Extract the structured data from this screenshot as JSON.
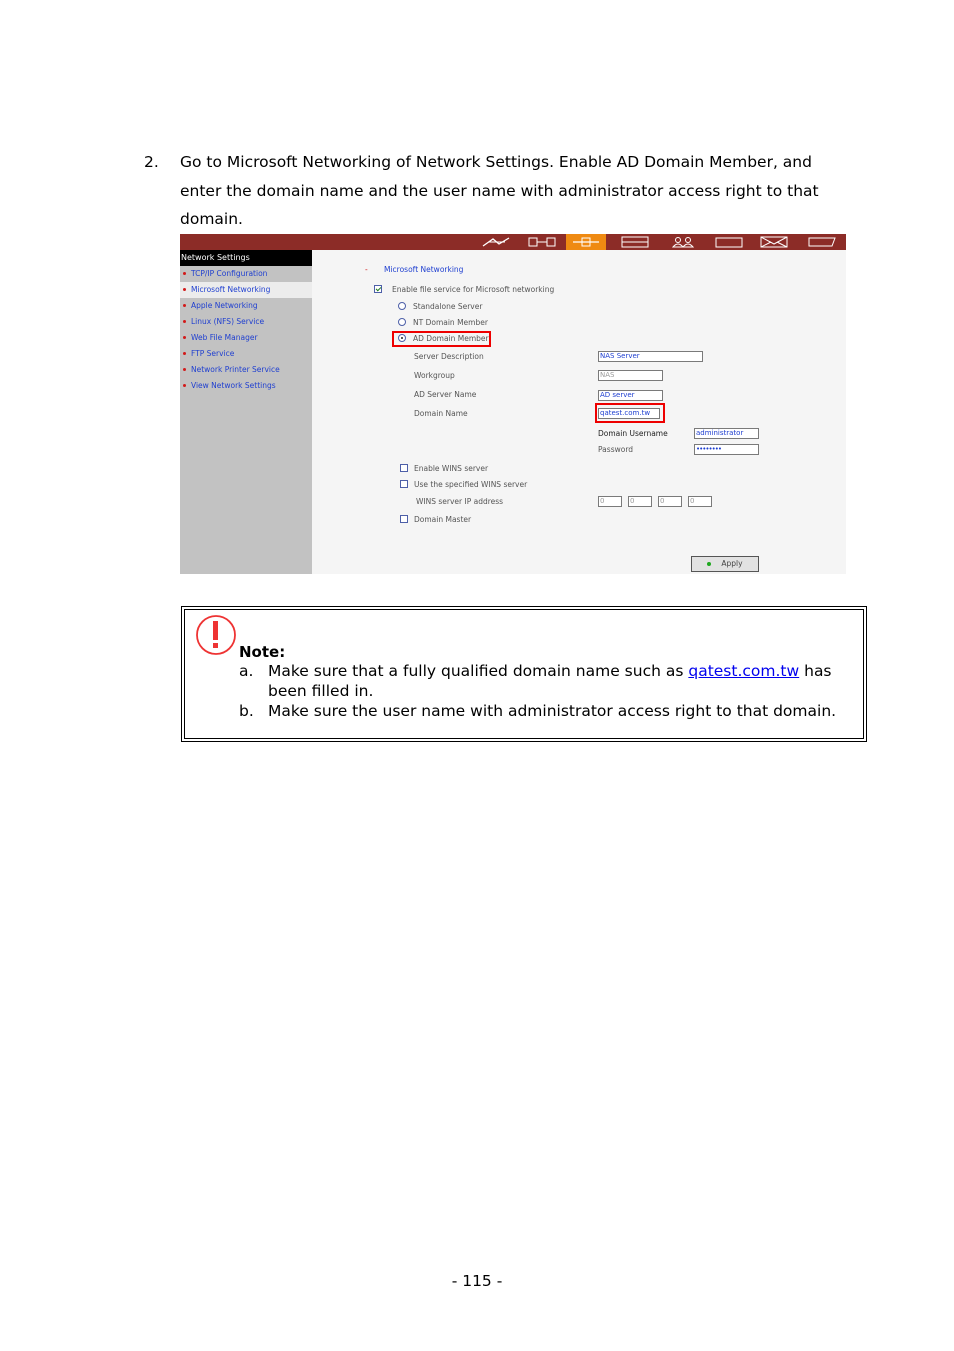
{
  "step": {
    "number": "2.",
    "text": "Go to Microsoft Networking of Network Settings.  Enable AD Domain Member, and enter the domain name and the user name with administrator access right to that domain."
  },
  "screenshot": {
    "topbar_icons": [
      "wizard-icon",
      "network-icon",
      "network-settings-icon",
      "storage-icon",
      "users-icon",
      "folder-icon",
      "mail-icon",
      "system-icon"
    ],
    "sidebar": {
      "title": "Network Settings",
      "items": [
        "TCP/IP Configuration",
        "Microsoft Networking",
        "Apple Networking",
        "Linux (NFS) Service",
        "Web File Manager",
        "FTP Service",
        "Network Printer Service",
        "View Network Settings"
      ]
    },
    "section_title": "Microsoft Networking",
    "enable_label": "Enable file service for Microsoft networking",
    "options": [
      "Standalone Server",
      "NT Domain Member",
      "AD Domain Member"
    ],
    "fields": {
      "server_description_label": "Server Description",
      "server_description_value": "NAS Server",
      "workgroup_label": "Workgroup",
      "workgroup_value": "NAS",
      "ad_server_name_label": "AD Server Name",
      "ad_server_name_value": "AD server",
      "domain_name_label": "Domain Name",
      "domain_name_value": "qatest.com.tw",
      "domain_username_label": "Domain Username",
      "domain_username_value": "administrator",
      "password_label": "Password",
      "password_value": "••••••••"
    },
    "wins": {
      "enable_label": "Enable WINS server",
      "specified_label": "Use the specified WINS server",
      "ip_label": "WINS server IP address",
      "ip": [
        "0",
        "0",
        "0",
        "0"
      ],
      "domain_master_label": "Domain Master"
    },
    "apply_label": "Apply"
  },
  "note": {
    "title": "Note:",
    "item_a_marker": "a.",
    "item_a_before": "Make sure that a fully qualified domain name such as ",
    "item_a_link": "qatest.com.tw",
    "item_a_after": " has been filled in.",
    "item_b_marker": "b.",
    "item_b_text": "Make sure the user name with administrator access right to that domain."
  },
  "page_number": "- 115 -"
}
